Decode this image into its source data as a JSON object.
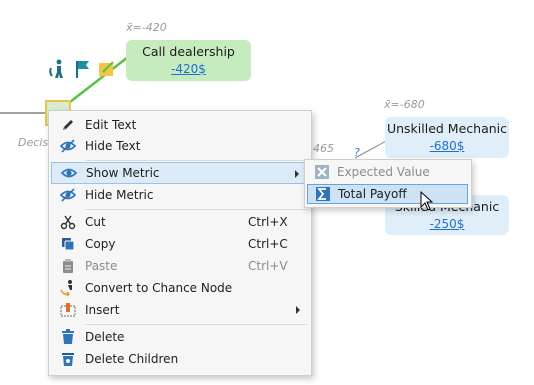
{
  "canvas": {
    "call_node": {
      "ev": "x̄=-420",
      "title": "Call dealership",
      "value": "-420$"
    },
    "unskilled_node": {
      "ev": "x̄=-680",
      "title": "Unskilled Mechanic",
      "value": "-680$"
    },
    "skilled_node": {
      "title": "Skilled Mechanic",
      "value": "-250$"
    },
    "edge_label": "465",
    "question_mark": "?",
    "decision_label": "Decision"
  },
  "menu": {
    "items": [
      {
        "label": "Edit Text",
        "icon": "pencil-icon"
      },
      {
        "label": "Hide Text",
        "icon": "eye-slash-icon"
      },
      {
        "label": "Show Metric",
        "icon": "eye-icon",
        "submenu": true
      },
      {
        "label": "Hide Metric",
        "icon": "eye-slash-icon"
      },
      {
        "label": "Cut",
        "shortcut": "Ctrl+X",
        "icon": "scissors-icon"
      },
      {
        "label": "Copy",
        "shortcut": "Ctrl+C",
        "icon": "copy-icon"
      },
      {
        "label": "Paste",
        "shortcut": "Ctrl+V",
        "icon": "clipboard-icon",
        "disabled": true
      },
      {
        "label": "Convert to Chance Node",
        "icon": "convert-icon"
      },
      {
        "label": "Insert",
        "icon": "insert-icon",
        "submenu": true
      },
      {
        "label": "Delete",
        "icon": "trash-icon"
      },
      {
        "label": "Delete Children",
        "icon": "trash-children-icon"
      }
    ]
  },
  "submenu": {
    "items": [
      {
        "label": "Expected Value",
        "icon": "x-icon",
        "disabled": true
      },
      {
        "label": "Total Payoff",
        "icon": "sigma-icon"
      }
    ]
  },
  "colors": {
    "accent": "#1f6fd1",
    "green_node": "#c6ebbf",
    "blue_node": "#e0eef9",
    "highlight": "#cde3f5"
  }
}
